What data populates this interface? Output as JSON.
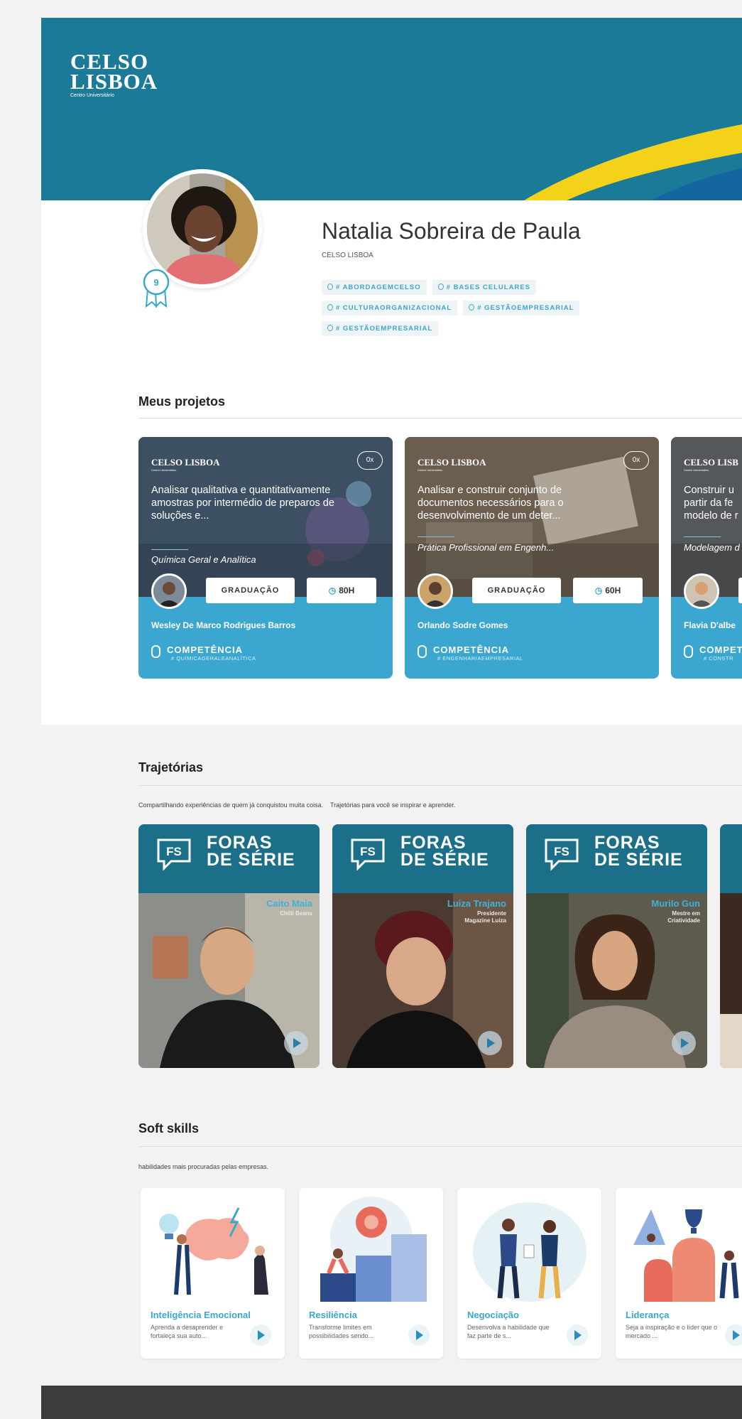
{
  "brand": {
    "logo_line1": "CELSO",
    "logo_line2": "LISBOA",
    "logo_sub": "Centro Universitário",
    "primary": "#1b7a98",
    "accent": "#3aa7cc",
    "yellow": "#f5d21a"
  },
  "profile": {
    "name": "Natalia Sobreira de Paula",
    "institution": "CELSO LISBOA",
    "level": "9",
    "tags": [
      "# ABORDAGEMCELSO",
      "# BASES CELULARES",
      "# CULTURAORGANIZACIONAL",
      "# GESTÃOEMPRESARIAL",
      "# GESTÃOEMPRESARIAL"
    ]
  },
  "projects": {
    "title": "Meus projetos",
    "items": [
      {
        "logo": "CELSO LISBOA",
        "logo_sub": "Centro Universitário",
        "count": "0x",
        "text": "Analisar qualitativa e quantitativamente amostras por intermédio de preparos de soluções e...",
        "course": "Química Geral e Analítica",
        "level": "GRADUAÇÃO",
        "hours": "80H",
        "professor": "Wesley De Marco Rodrigues Barros",
        "competence_label": "COMPETÊNCIA",
        "competence": "# QUÍMICAGERALEANALÍTICA"
      },
      {
        "logo": "CELSO LISBOA",
        "logo_sub": "Centro Universitário",
        "count": "0x",
        "text": "Analisar e construir conjunto de documentos necessários para o desenvolvimento de um deter...",
        "course": "Prática Profissional em Engenh...",
        "level": "GRADUAÇÃO",
        "hours": "60H",
        "professor": "Orlando Sodre Gomes",
        "competence_label": "COMPETÊNCIA",
        "competence": "# ENGENHARIAEMPRESARIAL"
      },
      {
        "logo": "CELSO LISB",
        "logo_sub": "Centro Universitário",
        "count": "",
        "text": "Construir u partir da fe modelo de r",
        "course": "Modelagem d",
        "level": "",
        "hours": "",
        "professor": "Flavia D'albe",
        "competence_label": "COMPET",
        "competence": "# CONSTR"
      }
    ]
  },
  "trajectories": {
    "title": "Trajetórias",
    "subtitle": "Compartilhando experiências de quem já conquistou muita coisa.    Trajetórias para você se inspirar e aprender.",
    "fs_line1": "FORAS",
    "fs_line2": "DE SÉRIE",
    "fs_mark": "FS",
    "items": [
      {
        "name": "Caito Maia",
        "role": "Chilli Beans"
      },
      {
        "name": "Luiza Trajano",
        "role": "Presidente Magazine Luiza"
      },
      {
        "name": "Murilo Gun",
        "role": "Mestre em Criatividade"
      },
      {
        "name": "",
        "role": ""
      }
    ]
  },
  "soft_skills": {
    "title": "Soft skills",
    "subtitle": "habilidades mais procuradas pelas empresas.",
    "items": [
      {
        "title": "Inteligência Emocional",
        "desc": "Aprenda a desaprender e fortaleça sua auto..."
      },
      {
        "title": "Resiliência",
        "desc": "Transforme limites em possibilidades sendo..."
      },
      {
        "title": "Negociação",
        "desc": "Desenvolva a habilidade que faz parte de s..."
      },
      {
        "title": "Liderança",
        "desc": "Seja a inspiração e o líder que o mercado ..."
      }
    ]
  }
}
